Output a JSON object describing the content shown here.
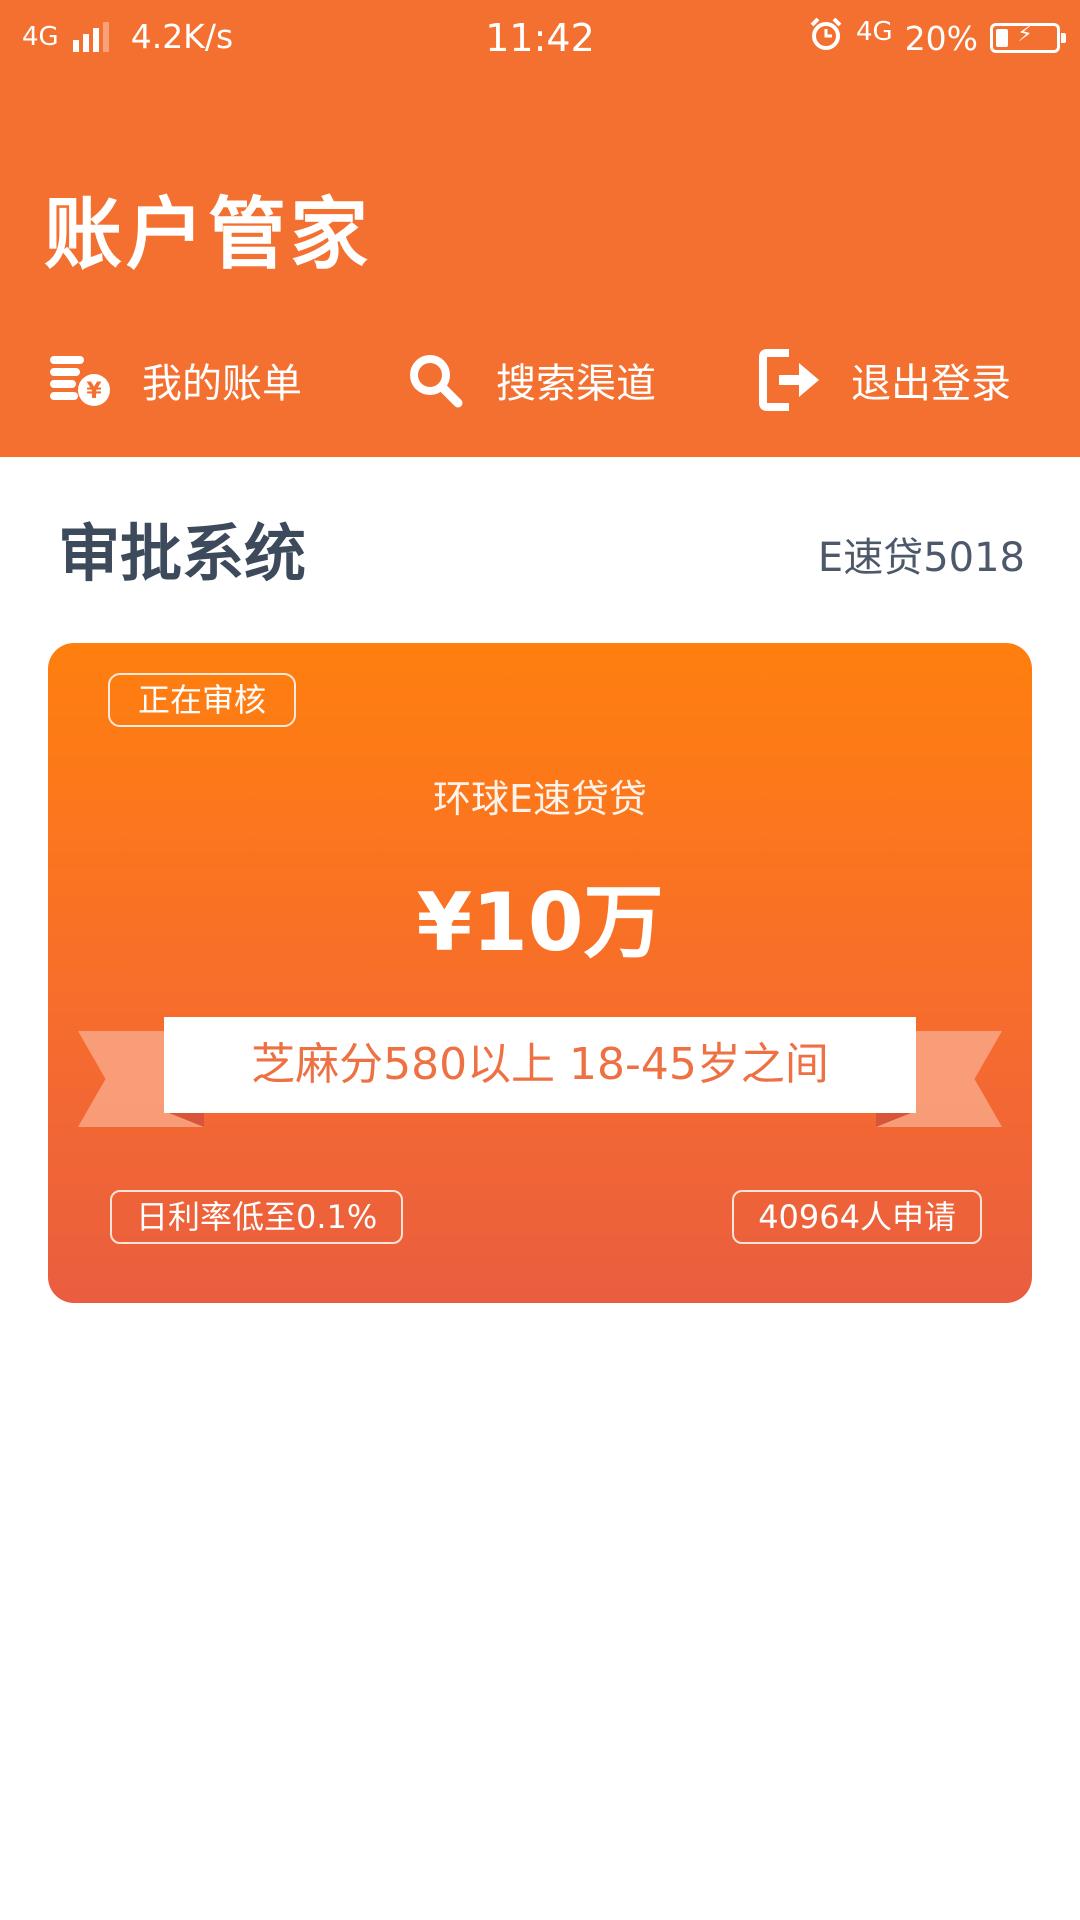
{
  "status_bar": {
    "network_left": "4G",
    "speed": "4.2K/s",
    "time": "11:42",
    "alarm_icon": "alarm-clock-icon",
    "network_right": "4G",
    "battery_percent_label": "20%",
    "battery_level": 0.2,
    "charging_icon": "lightning-bolt-icon"
  },
  "header": {
    "title": "账户管家",
    "nav": [
      {
        "label": "我的账单",
        "icon": "coin-stack-yen-icon"
      },
      {
        "label": "搜索渠道",
        "icon": "search-icon"
      },
      {
        "label": "退出登录",
        "icon": "logout-icon"
      }
    ]
  },
  "section": {
    "title": "审批系统",
    "subtitle": "E速贷5018"
  },
  "loan_card": {
    "status_tag": "正在审核",
    "product_name": "环球E速贷贷",
    "amount": "¥10万",
    "requirements": "芝麻分580以上  18-45岁之间",
    "rate": "日利率低至0.1%",
    "applicants": "40964人申请"
  },
  "colors": {
    "header_bg": "#f47030",
    "card_top": "#ff7f0e",
    "card_bottom": "#ea5d40",
    "ribbon_text": "#ee7143",
    "section_title": "#3d4a5c"
  }
}
